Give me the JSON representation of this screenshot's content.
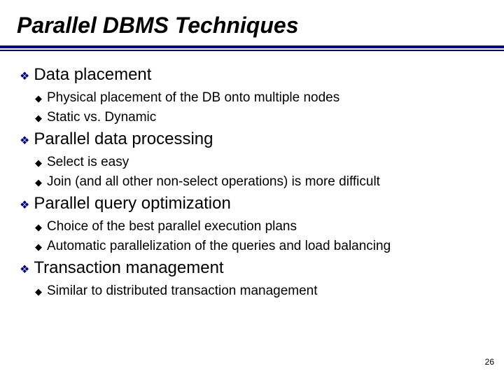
{
  "title": "Parallel DBMS Techniques",
  "sections": [
    {
      "heading": "Data placement",
      "items": [
        "Physical placement of the DB onto multiple nodes",
        "Static vs. Dynamic"
      ]
    },
    {
      "heading": "Parallel data processing",
      "items": [
        "Select is easy",
        "Join (and all other non-select operations) is more difficult"
      ]
    },
    {
      "heading": "Parallel query optimization",
      "items": [
        "Choice of the best parallel execution plans",
        "Automatic parallelization of the queries and load balancing"
      ]
    },
    {
      "heading": "Transaction management",
      "items": [
        "Similar to distributed transaction management"
      ]
    }
  ],
  "page_number": "26",
  "bullets": {
    "l1": "❖",
    "l2": "◆"
  }
}
